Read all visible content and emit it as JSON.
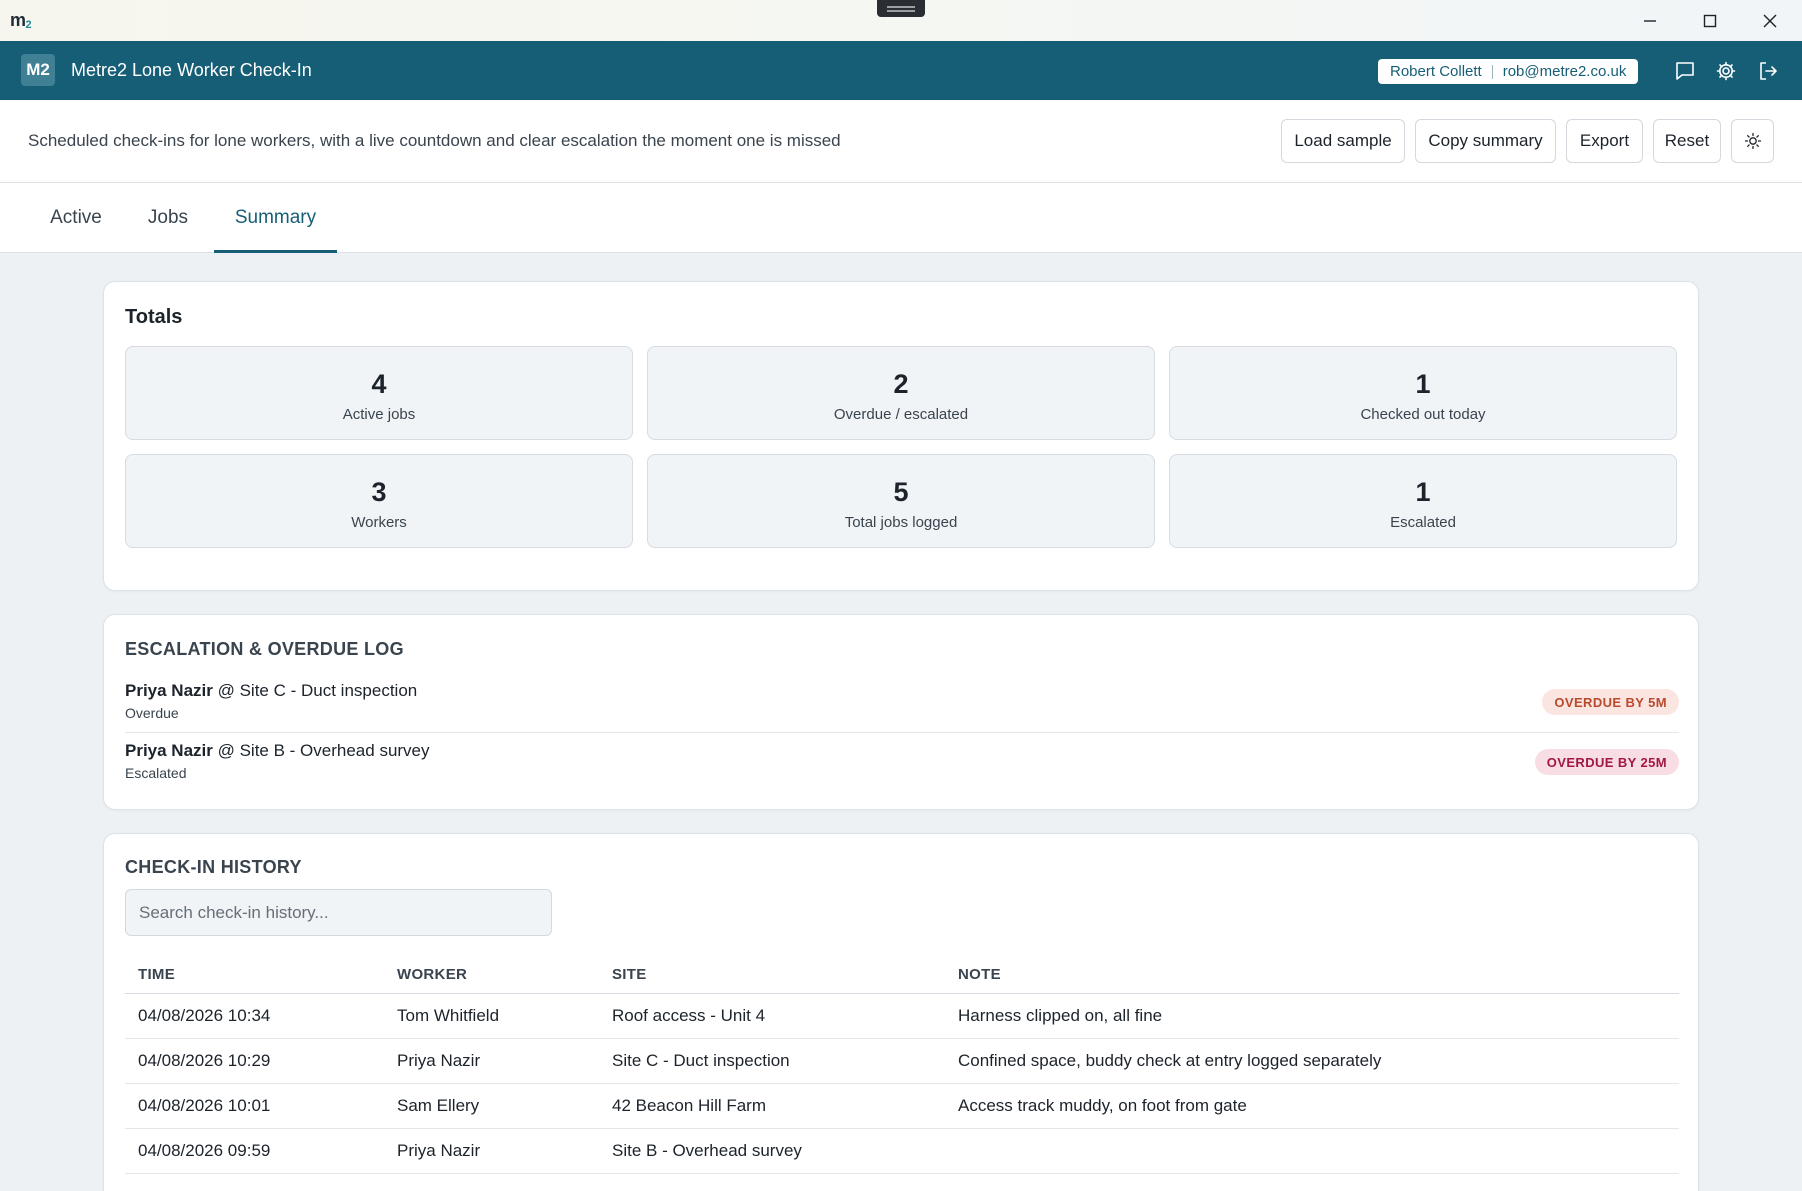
{
  "window": {
    "logo_text": "m",
    "logo_sub": "2"
  },
  "header": {
    "badge": "M2",
    "title": "Metre2 Lone Worker Check-In",
    "user_name": "Robert Collett",
    "user_email": "rob@metre2.co.uk"
  },
  "subheader": {
    "description": "Scheduled check-ins for lone workers, with a live countdown and clear escalation the moment one is missed",
    "buttons": {
      "load_sample": "Load sample",
      "copy_summary": "Copy summary",
      "export": "Export",
      "reset": "Reset"
    }
  },
  "tabs": [
    {
      "label": "Active"
    },
    {
      "label": "Jobs"
    },
    {
      "label": "Summary"
    }
  ],
  "totals": {
    "title": "Totals",
    "stats": [
      {
        "value": "4",
        "label": "Active jobs"
      },
      {
        "value": "2",
        "label": "Overdue / escalated"
      },
      {
        "value": "1",
        "label": "Checked out today"
      },
      {
        "value": "3",
        "label": "Workers"
      },
      {
        "value": "5",
        "label": "Total jobs logged"
      },
      {
        "value": "1",
        "label": "Escalated"
      }
    ]
  },
  "escalation_log": {
    "title": "ESCALATION & OVERDUE LOG",
    "items": [
      {
        "worker": "Priya Nazir",
        "site": " @ Site C - Duct inspection",
        "status": "Overdue",
        "badge": "OVERDUE BY 5M"
      },
      {
        "worker": "Priya Nazir",
        "site": " @ Site B - Overhead survey",
        "status": "Escalated",
        "badge": "OVERDUE BY 25M"
      }
    ]
  },
  "history": {
    "title": "CHECK-IN HISTORY",
    "search_placeholder": "Search check-in history...",
    "columns": [
      "TIME",
      "WORKER",
      "SITE",
      "NOTE"
    ],
    "rows": [
      {
        "time": "04/08/2026 10:34",
        "worker": "Tom Whitfield",
        "site": "Roof access - Unit 4",
        "note": "Harness clipped on, all fine"
      },
      {
        "time": "04/08/2026 10:29",
        "worker": "Priya Nazir",
        "site": "Site C - Duct inspection",
        "note": "Confined space, buddy check at entry logged separately"
      },
      {
        "time": "04/08/2026 10:01",
        "worker": "Sam Ellery",
        "site": "42 Beacon Hill Farm",
        "note": "Access track muddy, on foot from gate"
      },
      {
        "time": "04/08/2026 09:59",
        "worker": "Priya Nazir",
        "site": "Site B - Overhead survey",
        "note": ""
      }
    ]
  },
  "colors": {
    "brand": "#165e76",
    "overdue_text": "#b84a2d",
    "overdue_bg": "#fbe5e1",
    "escalated_text": "#a11843",
    "escalated_bg": "#f8dde4"
  },
  "icons": {
    "chat": "chat-icon",
    "settings": "gear-icon",
    "logout": "logout-icon",
    "theme": "sun-icon"
  }
}
